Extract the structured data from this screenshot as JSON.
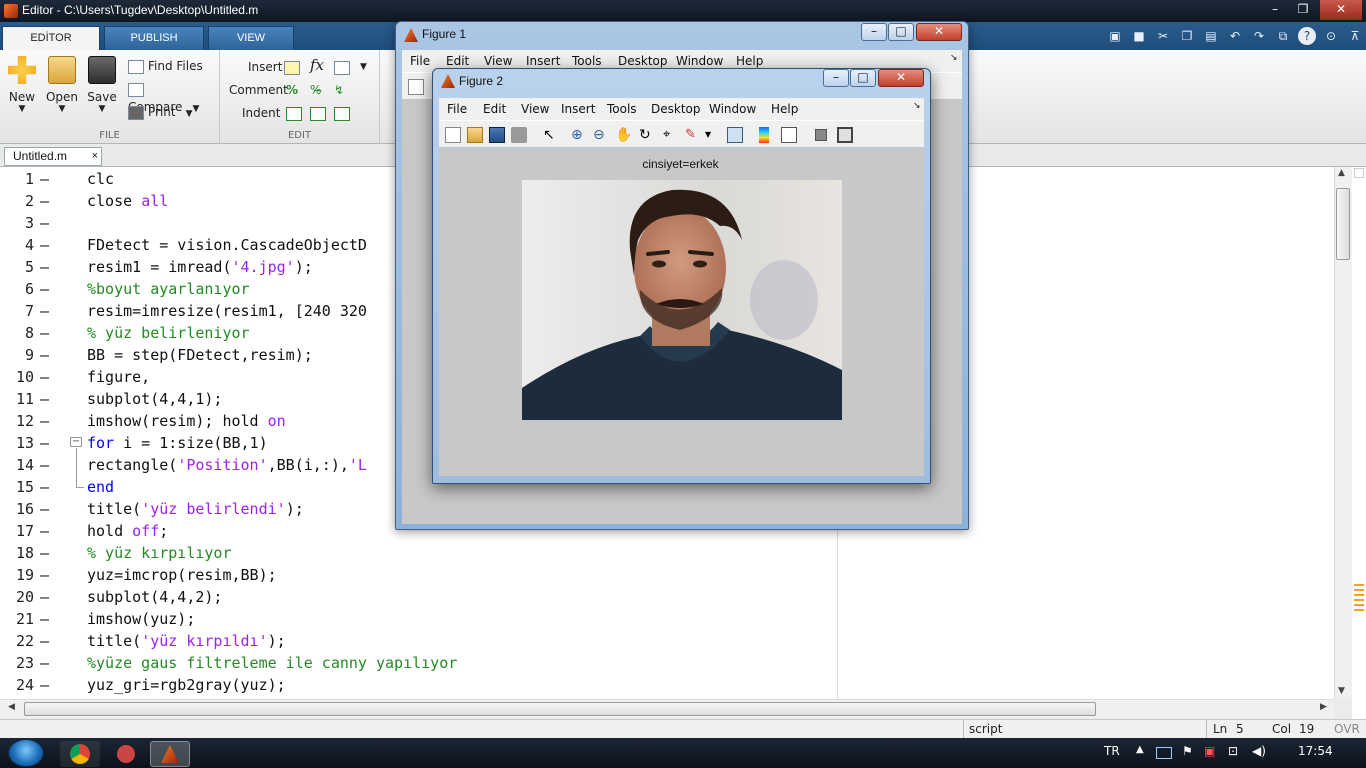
{
  "window": {
    "title": "Editor - C:\\Users\\Tugdev\\Desktop\\Untitled.m",
    "minimize": "–",
    "maximize": "❐",
    "close": "✕"
  },
  "tabs": [
    {
      "label": "EDİTOR"
    },
    {
      "label": "PUBLISH"
    },
    {
      "label": "VIEW"
    }
  ],
  "ribbon": {
    "file_group": {
      "label": "FILE",
      "new": "New",
      "open": "Open",
      "save": "Save",
      "find_files": "Find Files",
      "compare": "Compare",
      "print": "Print"
    },
    "edit_group": {
      "label": "EDIT",
      "insert": "Insert",
      "comment": "Comment",
      "indent": "Indent",
      "fx": "fx"
    }
  },
  "editor": {
    "doc_tab": "Untitled.m",
    "doc_tab_close": "×",
    "lines": [
      {
        "n": "1",
        "segs": [
          [
            "p",
            "clc"
          ]
        ]
      },
      {
        "n": "2",
        "segs": [
          [
            "p",
            "close "
          ],
          [
            "s",
            "all"
          ]
        ]
      },
      {
        "n": "3",
        "segs": []
      },
      {
        "n": "4",
        "segs": [
          [
            "p",
            "FDetect = vision.CascadeObjectD"
          ]
        ]
      },
      {
        "n": "5",
        "segs": [
          [
            "p",
            "resim1 = imread("
          ],
          [
            "s",
            "'4.jpg'"
          ],
          [
            "p",
            ");"
          ]
        ]
      },
      {
        "n": "6",
        "segs": [
          [
            "c",
            "%boyut ayarlanıyor"
          ]
        ]
      },
      {
        "n": "7",
        "segs": [
          [
            "p",
            "resim=imresize(resim1, [240 320"
          ]
        ]
      },
      {
        "n": "8",
        "segs": [
          [
            "c",
            "% yüz belirleniyor"
          ]
        ]
      },
      {
        "n": "9",
        "segs": [
          [
            "p",
            "BB = step(FDetect,resim);"
          ]
        ]
      },
      {
        "n": "10",
        "segs": [
          [
            "p",
            "figure,"
          ]
        ]
      },
      {
        "n": "11",
        "segs": [
          [
            "p",
            "subplot(4,4,1);"
          ]
        ]
      },
      {
        "n": "12",
        "segs": [
          [
            "p",
            "imshow(resim); hold "
          ],
          [
            "s",
            "on"
          ]
        ]
      },
      {
        "n": "13",
        "segs": [
          [
            "k",
            "for"
          ],
          [
            "p",
            " i = 1:size(BB,1)"
          ]
        ]
      },
      {
        "n": "14",
        "segs": [
          [
            "p",
            "rectangle("
          ],
          [
            "s",
            "'Position'"
          ],
          [
            "p",
            ",BB(i,:),"
          ],
          [
            "s",
            "'L"
          ]
        ]
      },
      {
        "n": "15",
        "segs": [
          [
            "k",
            "end"
          ]
        ]
      },
      {
        "n": "16",
        "segs": [
          [
            "p",
            "title("
          ],
          [
            "s",
            "'yüz belirlendi'"
          ],
          [
            "p",
            ");"
          ]
        ]
      },
      {
        "n": "17",
        "segs": [
          [
            "p",
            "hold "
          ],
          [
            "s",
            "off"
          ],
          [
            "p",
            ";"
          ]
        ]
      },
      {
        "n": "18",
        "segs": [
          [
            "c",
            "% yüz kırpılıyor"
          ]
        ]
      },
      {
        "n": "19",
        "segs": [
          [
            "p",
            "yuz=imcrop(resim,BB);"
          ]
        ]
      },
      {
        "n": "20",
        "segs": [
          [
            "p",
            "subplot(4,4,2);"
          ]
        ]
      },
      {
        "n": "21",
        "segs": [
          [
            "p",
            "imshow(yuz);"
          ]
        ]
      },
      {
        "n": "22",
        "segs": [
          [
            "p",
            "title("
          ],
          [
            "s",
            "'yüz kırpıldı'"
          ],
          [
            "p",
            ");"
          ]
        ]
      },
      {
        "n": "23",
        "segs": [
          [
            "c",
            "%yüze gaus filtreleme ile canny yapılıyor"
          ]
        ]
      },
      {
        "n": "24",
        "segs": [
          [
            "p",
            "yuz_gri=rgb2gray(yuz);"
          ]
        ]
      }
    ]
  },
  "status": {
    "type": "script",
    "ln_label": "Ln",
    "ln": "5",
    "col_label": "Col",
    "col": "19",
    "ovr": "OVR"
  },
  "figure1": {
    "title": "Figure 1",
    "menu": [
      "File",
      "Edit",
      "View",
      "Insert",
      "Tools",
      "Desktop",
      "Window",
      "Help"
    ]
  },
  "figure2": {
    "title": "Figure 2",
    "menu": [
      "File",
      "Edit",
      "View",
      "Insert",
      "Tools",
      "Desktop",
      "Window",
      "Help"
    ],
    "axes_title": "cinsiyet=erkek"
  },
  "taskbar": {
    "lang": "TR",
    "clock": "17:54"
  },
  "colors": {
    "keyword": "#0000ff",
    "string": "#a020f0",
    "comment": "#228b22",
    "ribbon_tab": "#2a5c8c"
  }
}
